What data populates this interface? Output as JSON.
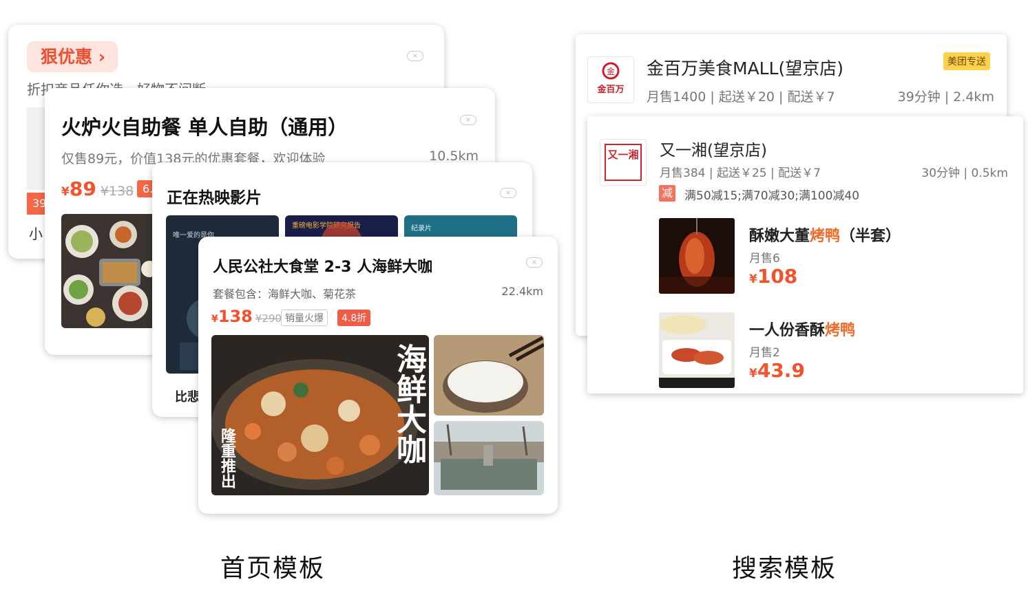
{
  "home": {
    "caption": "首页模板",
    "card1": {
      "tag": "狠优惠 ›",
      "subtitle": "折扣商品任你选，好物不间断",
      "price_tag": "39",
      "small_text": "小"
    },
    "card2": {
      "title": "火炉火自助餐 单人自助（通用）",
      "description": "仅售89元，价值138元的优惠套餐，欢迎体验",
      "distance": "10.5km",
      "currency": "¥",
      "price": "89",
      "original_price": "¥138",
      "discount": "6."
    },
    "card3": {
      "title": "正在热映影片",
      "bottom_text": "比悲",
      "posters": [
        {
          "text": "唯一爱的是你"
        },
        {
          "text": "重磅电影学院研究报告"
        },
        {
          "text": "纪录片"
        }
      ]
    },
    "card4": {
      "title": "人民公社大食堂 2-3 人海鲜大咖",
      "description": "套餐包含：海鲜大咖、菊花茶",
      "distance": "22.4km",
      "currency": "¥",
      "price": "138",
      "original_price": "¥290",
      "badge_hot": "销量火爆",
      "badge_discount": "4.8折",
      "photo_calligraphy": "海鲜大咖",
      "photo_caption": "隆重推出"
    }
  },
  "search": {
    "caption": "搜索模板",
    "store1": {
      "logo_text": "金百万",
      "name": "金百万美食MALL(望京店)",
      "stats": "月售1400 | 起送￥20 | 配送￥7",
      "time_distance": "39分钟 | 2.4km",
      "delivery_badge": "美团专送"
    },
    "store2": {
      "logo_text": "又一湘",
      "name": "又一湘(望京店)",
      "stats": "月售384 | 起送￥25 | 配送￥7",
      "time_distance": "30分钟 | 0.5km",
      "promo_icon": "减",
      "promo_text": "满50减15;满70减30;满100减40",
      "dishes": [
        {
          "name_a": "酥嫩大董",
          "name_hl": "烤鸭",
          "name_b": "（半套）",
          "sold": "月售6",
          "currency": "¥",
          "price": "108"
        },
        {
          "name_a": "一人份香酥",
          "name_hl": "烤鸭",
          "name_b": "",
          "sold": "月售2",
          "currency": "¥",
          "price": "43.9"
        }
      ]
    }
  },
  "colors": {
    "accent_red": "#f4522d",
    "badge_yellow": "#ffd24d",
    "highlight_orange": "#f06a2a"
  }
}
